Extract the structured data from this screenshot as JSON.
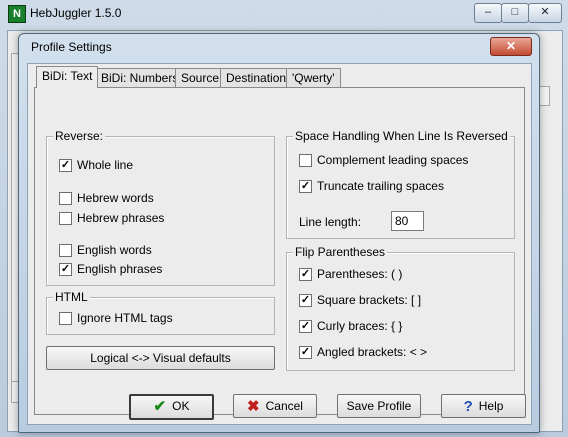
{
  "main_window": {
    "title": "HebJuggler 1.5.0",
    "app_icon_glyph": "N",
    "minimize_glyph": "–",
    "maximize_glyph": "□",
    "close_glyph": "✕"
  },
  "dialog": {
    "title": "Profile Settings",
    "close_glyph": "✕",
    "tabs": [
      {
        "label": "BiDi: Text"
      },
      {
        "label": "BiDi: Numbers"
      },
      {
        "label": "Source"
      },
      {
        "label": "Destination"
      },
      {
        "label": "'Qwerty'"
      }
    ],
    "reverse_group": {
      "label": "Reverse:",
      "whole_line": {
        "label": "Whole line",
        "checked": true
      },
      "hebrew_words": {
        "label": "Hebrew words",
        "checked": false
      },
      "hebrew_phrases": {
        "label": "Hebrew phrases",
        "checked": false
      },
      "english_words": {
        "label": "English words",
        "checked": false
      },
      "english_phrases": {
        "label": "English phrases",
        "checked": true
      }
    },
    "html_group": {
      "label": "HTML",
      "ignore_html_tags": {
        "label": "Ignore HTML tags",
        "checked": false
      }
    },
    "logical_visual_button": "Logical <-> Visual defaults",
    "space_group": {
      "label": "Space Handling When Line Is Reversed",
      "complement_leading": {
        "label": "Complement leading spaces",
        "checked": false
      },
      "truncate_trailing": {
        "label": "Truncate trailing spaces",
        "checked": true
      },
      "line_length_label": "Line length:",
      "line_length_value": "80"
    },
    "flip_group": {
      "label": "Flip Parentheses",
      "parentheses": {
        "label": "Parentheses:  (  )",
        "checked": true
      },
      "square_brackets": {
        "label": "Square brackets:  [  ]",
        "checked": true
      },
      "curly_braces": {
        "label": "Curly braces:  {  }",
        "checked": true
      },
      "angled_brackets": {
        "label": "Angled brackets:  < >",
        "checked": true
      }
    },
    "buttons": {
      "ok": "OK",
      "cancel": "Cancel",
      "save_profile": "Save Profile",
      "help": "Help"
    },
    "check_glyph": "✓",
    "ok_icon_glyph": "✔",
    "cancel_icon_glyph": "✖",
    "help_icon_glyph": "?"
  },
  "colors": {
    "ok_icon": "#1a8a1a",
    "cancel_icon": "#c0201a",
    "help_icon": "#1f4fb3"
  }
}
